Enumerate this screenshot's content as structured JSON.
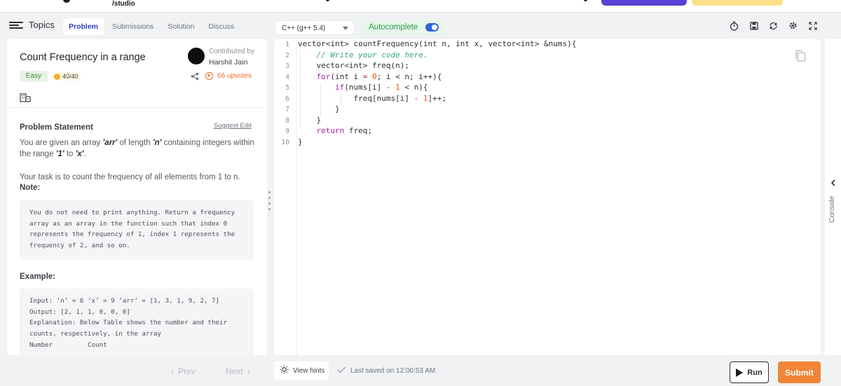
{
  "header": {
    "breadcrumb": "/studio"
  },
  "nav": {
    "topics_label": "Topics",
    "tabs": [
      "Problem",
      "Submissions",
      "Solution",
      "Discuss"
    ]
  },
  "editor_toolbar": {
    "language": "C++ (g++ 5.4)",
    "autocomplete_label": "Autocomplete",
    "autocomplete_on": true,
    "icons": [
      "timer-icon",
      "save-icon",
      "reset-icon",
      "settings-icon",
      "fullscreen-icon"
    ]
  },
  "problem": {
    "title": "Count Frequency in a range",
    "contributed_label": "Contributed by",
    "author": "Harshit Jain",
    "difficulty": "Easy",
    "score": "40/40",
    "upvotes": "66 upvotes",
    "statement_heading": "Problem Statement",
    "suggest_edit": "Suggest Edit",
    "statement_p1_a": "You are given an array ",
    "statement_p1_arr": "'arr'",
    "statement_p1_b": " of length ",
    "statement_p1_n": "'n'",
    "statement_p1_c": " containing integers within the range ",
    "statement_p1_1": "'1'",
    "statement_p1_d": " to ",
    "statement_p1_x": "'x'",
    "statement_p1_e": ".",
    "statement_p2": "Your task is to count the frequency of all elements from 1 to n.",
    "note_heading": "Note:",
    "note_text": "You do not need to print anything. Return a frequency\narray as an array in the function such that index 0\nrepresents the frequency of 1, index 1 represents the\nfrequency of 2, and so on.",
    "example_heading": "Example:",
    "example_text": "Input: ‘n’ = 6 ‘x’ = 9 ‘arr’ = [1, 3, 1, 9, 2, 7]\nOutput: [2, 1, 1, 0, 0, 0]\nExplanation: Below Table shows the number and their\ncounts, respectively, in the array\nNumber         Count"
  },
  "code": {
    "line_numbers": [
      "1",
      "2",
      "3",
      "4",
      "5",
      "6",
      "7",
      "8",
      "9",
      "10"
    ]
  },
  "console": {
    "label": "Console"
  },
  "footer": {
    "prev": "Prev",
    "next": "Next",
    "view_hints": "View hints",
    "last_saved": "Last saved on 12:00:53 AM",
    "run": "Run",
    "submit": "Submit"
  },
  "colors": {
    "accent_blue": "#2f3fbf",
    "autocomplete_green": "#2c9b51",
    "upvote_orange": "#ef6a2b",
    "submit_orange": "#f08437"
  }
}
